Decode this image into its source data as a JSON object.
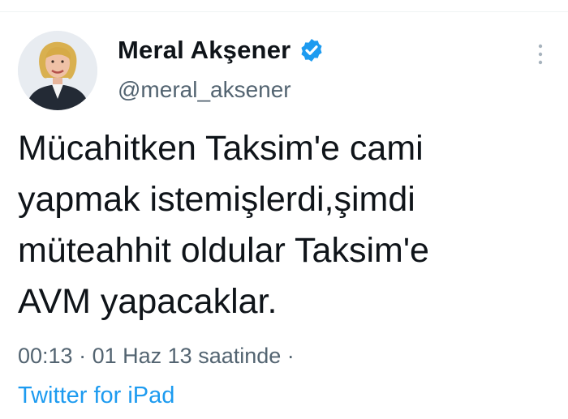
{
  "tweet": {
    "author": {
      "display_name": "Meral Akşener",
      "handle": "@meral_aksener",
      "verified": true,
      "avatar_icon": "profile-photo"
    },
    "text_lines": [
      "Mücahitken Taksim'e cami",
      "yapmak istemişlerdi,şimdi",
      "müteahhit oldular Taksim'e",
      "AVM yapacaklar."
    ],
    "meta": {
      "time": "00:13",
      "separator": "·",
      "date": "01 Haz 13 saatinde",
      "trailing_separator": "·"
    },
    "source": "Twitter for iPad"
  },
  "icons": {
    "verified": "verified-badge-icon",
    "more": "more-options-icon"
  },
  "colors": {
    "text_primary": "#0f1419",
    "text_secondary": "#536471",
    "accent": "#1d9bf0"
  }
}
